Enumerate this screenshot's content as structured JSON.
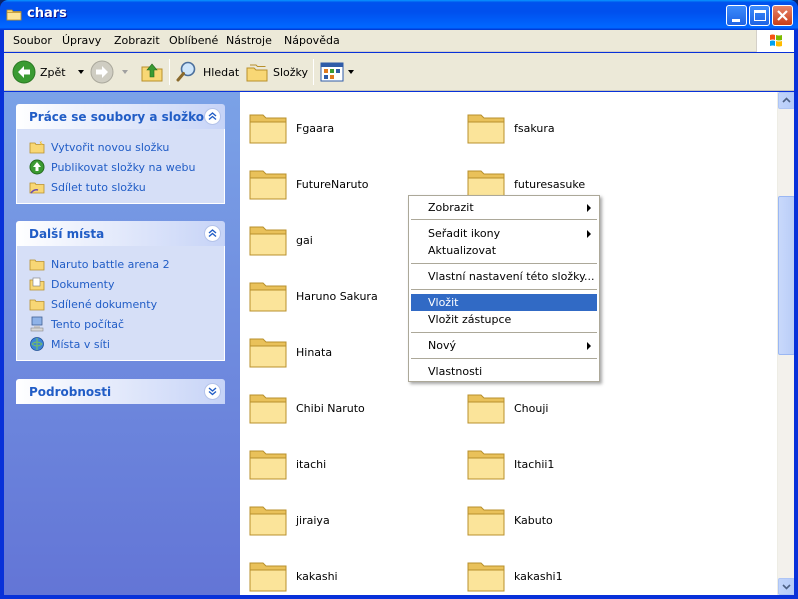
{
  "window": {
    "title": "chars"
  },
  "menubar": {
    "items": [
      {
        "label": "Soubor"
      },
      {
        "label": "Úpravy"
      },
      {
        "label": "Zobrazit"
      },
      {
        "label": "Oblíbené"
      },
      {
        "label": "Nástroje"
      },
      {
        "label": "Nápověda"
      }
    ]
  },
  "toolbar": {
    "back_label": "Zpět",
    "search_label": "Hledat",
    "folders_label": "Složky"
  },
  "sidebar": {
    "tasks": {
      "title": "Práce se soubory a složkou",
      "items": [
        {
          "label": "Vytvořit novou složku",
          "icon": "new-folder-icon"
        },
        {
          "label": "Publikovat složky na webu",
          "icon": "publish-web-icon"
        },
        {
          "label": "Sdílet tuto složku",
          "icon": "share-folder-icon"
        }
      ]
    },
    "places": {
      "title": "Další místa",
      "items": [
        {
          "label": "Naruto battle arena 2",
          "icon": "folder-icon"
        },
        {
          "label": "Dokumenty",
          "icon": "documents-icon"
        },
        {
          "label": "Sdílené dokumenty",
          "icon": "shared-documents-icon"
        },
        {
          "label": "Tento počítač",
          "icon": "computer-icon"
        },
        {
          "label": "Místa v síti",
          "icon": "network-icon"
        }
      ]
    },
    "details": {
      "title": "Podrobnosti"
    }
  },
  "files": {
    "left": [
      "Fgaara",
      "FutureNaruto",
      "gai",
      "Haruno Sakura",
      "Hinata",
      "Chibi Naruto",
      "itachi",
      "jiraiya",
      "kakashi"
    ],
    "right": [
      "fsakura",
      "futuresasuke",
      "Chouji",
      "Itachii1",
      "Kabuto",
      "kakashi1"
    ]
  },
  "context_menu": {
    "items": [
      {
        "label": "Zobrazit",
        "submenu": true
      },
      {
        "label": "Seřadit ikony",
        "submenu": true
      },
      {
        "label": "Aktualizovat"
      },
      {
        "label": "Vlastní nastavení této složky..."
      },
      {
        "label": "Vložit",
        "selected": true
      },
      {
        "label": "Vložit zástupce"
      },
      {
        "label": "Nový",
        "submenu": true
      },
      {
        "label": "Vlastnosti"
      }
    ]
  },
  "colors": {
    "titlebar": "#0053ee",
    "sidebar_link": "#215dc6",
    "menu_highlight": "#316ac5",
    "folder": "#f8d775"
  }
}
